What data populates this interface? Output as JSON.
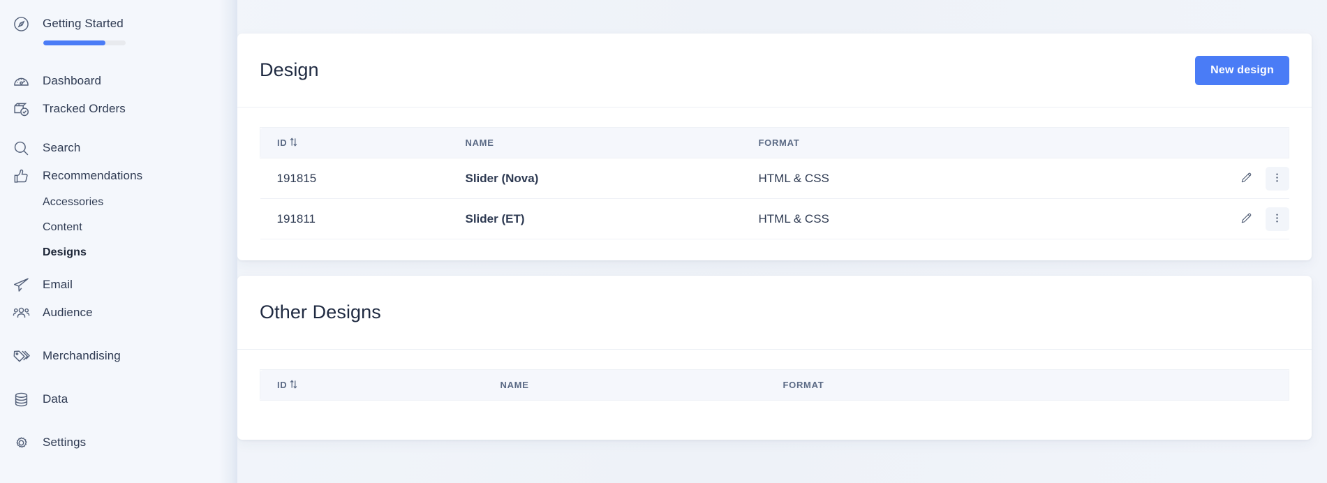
{
  "sidebar": {
    "getting_started": {
      "label": "Getting Started",
      "icon": "compass-icon",
      "progress_percent": 75
    },
    "groups": [
      {
        "items": [
          {
            "label": "Dashboard",
            "icon": "gauge-icon"
          },
          {
            "label": "Tracked Orders",
            "icon": "package-check-icon"
          }
        ]
      },
      {
        "items": [
          {
            "label": "Search",
            "icon": "magnifier-icon"
          },
          {
            "label": "Recommendations",
            "icon": "thumbs-up-icon"
          }
        ],
        "sub_items": [
          {
            "label": "Accessories",
            "active": false
          },
          {
            "label": "Content",
            "active": false
          },
          {
            "label": "Designs",
            "active": true
          }
        ]
      },
      {
        "items": [
          {
            "label": "Email",
            "icon": "paper-plane-icon"
          },
          {
            "label": "Audience",
            "icon": "people-icon"
          }
        ]
      },
      {
        "items": [
          {
            "label": "Merchandising",
            "icon": "tags-icon"
          }
        ]
      },
      {
        "items": [
          {
            "label": "Data",
            "icon": "database-icon"
          }
        ]
      },
      {
        "items": [
          {
            "label": "Settings",
            "icon": "gear-icon"
          }
        ]
      }
    ]
  },
  "design_card": {
    "title": "Design",
    "new_button_label": "New design",
    "columns": {
      "id": "ID",
      "name": "NAME",
      "format": "FORMAT"
    },
    "rows": [
      {
        "id": "191815",
        "name": "Slider (Nova)",
        "format": "HTML & CSS"
      },
      {
        "id": "191811",
        "name": "Slider (ET)",
        "format": "HTML & CSS"
      }
    ],
    "row_actions": {
      "edit": "pencil-icon",
      "more": "kebab-menu-icon"
    }
  },
  "other_designs_card": {
    "title": "Other Designs",
    "columns": {
      "id": "ID",
      "name": "NAME",
      "format": "FORMAT"
    },
    "rows": []
  },
  "colors": {
    "accent": "#4a7cf6",
    "page_bg": "#f2f5fa",
    "sidebar_bg": "#f4f7fc",
    "card_bg": "#ffffff",
    "table_head_bg": "#f5f7fc",
    "muted_text": "#a9b2c4",
    "heading_text": "#1f2a41"
  }
}
